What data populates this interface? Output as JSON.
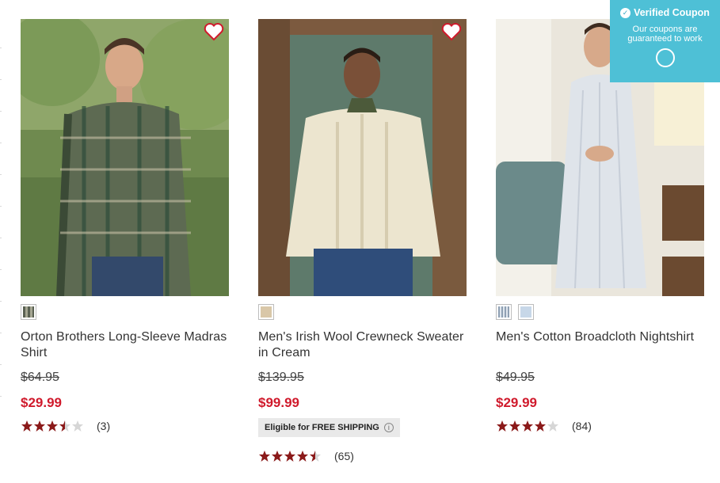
{
  "products": [
    {
      "name": "Orton Brothers Long-Sleeve Madras Shirt",
      "old_price": "$64.95",
      "sale_price": "$29.99",
      "rating": 3.5,
      "review_count": "(3)",
      "free_shipping": false,
      "swatches": [
        "#7a7f6a"
      ]
    },
    {
      "name": "Men's Irish Wool Crewneck Sweater in Cream",
      "old_price": "$139.95",
      "sale_price": "$99.99",
      "rating": 4.5,
      "review_count": "(65)",
      "free_shipping": true,
      "shipping_label": "Eligible for FREE SHIPPING",
      "swatches": [
        "#d9c7a8"
      ]
    },
    {
      "name": "Men's Cotton Broadcloth Nightshirt",
      "old_price": "$49.95",
      "sale_price": "$29.99",
      "rating": 4,
      "review_count": "(84)",
      "free_shipping": false,
      "swatches": [
        "#aab6c4",
        "#c7d7e8"
      ]
    }
  ],
  "coupon": {
    "title": "Verified Coupon",
    "subtitle": "Our coupons are guaranteed to work"
  },
  "colors": {
    "sale": "#d01a2c",
    "star": "#8b1a1a",
    "coupon_bg": "#4ec0d6"
  }
}
